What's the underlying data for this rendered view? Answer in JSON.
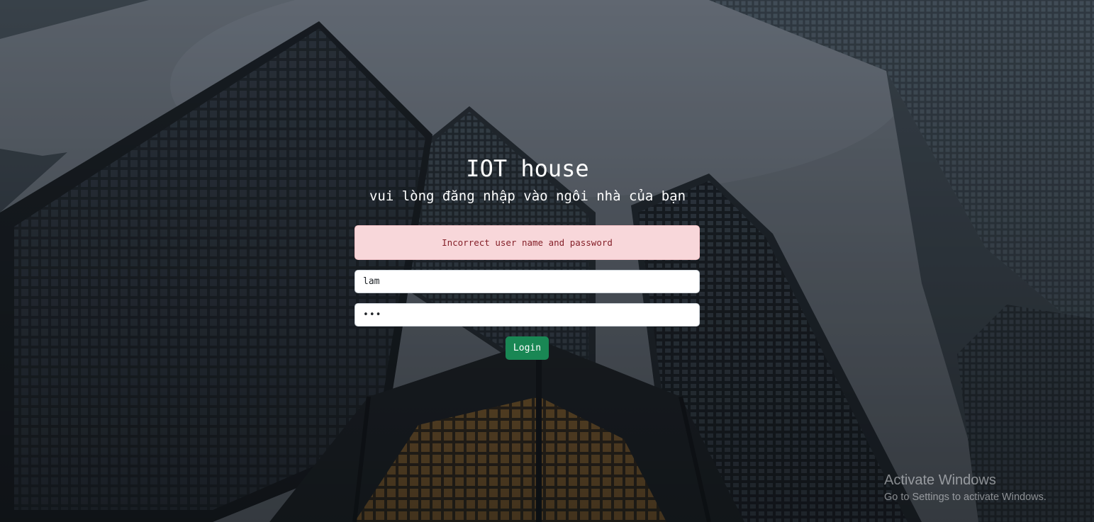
{
  "login": {
    "title": "IOT house",
    "subtitle": "vui lòng đăng nhập vào ngôi nhà của bạn",
    "error_message": "Incorrect user name and password",
    "username_value": "lam",
    "password_value": "•••",
    "login_button": "Login"
  },
  "watermark": {
    "title": "Activate Windows",
    "subtitle": "Go to Settings to activate Windows."
  },
  "colors": {
    "alert_background": "#f8d7da",
    "alert_text": "#842029",
    "login_button": "#198754",
    "title_text": "#ffffff"
  },
  "background": {
    "description_icon": "skyscrapers-background-image"
  }
}
